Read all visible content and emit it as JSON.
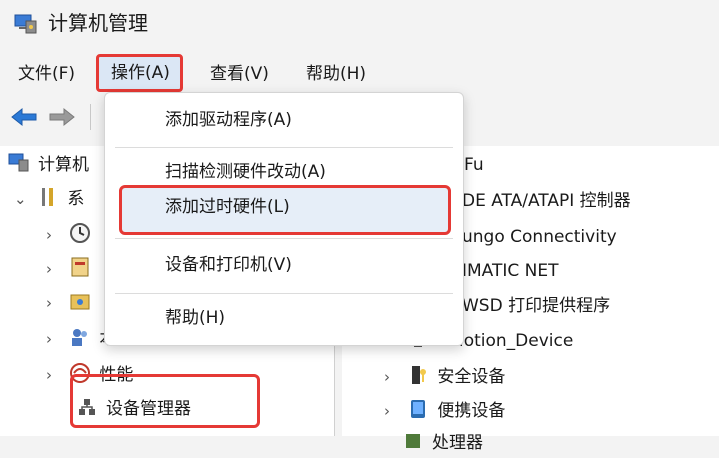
{
  "window": {
    "title": "计算机管理"
  },
  "menubar": {
    "items": [
      {
        "label": "文件(F)"
      },
      {
        "label": "操作(A)"
      },
      {
        "label": "查看(V)"
      },
      {
        "label": "帮助(H)"
      }
    ]
  },
  "dropdown": {
    "items": [
      {
        "label": "添加驱动程序(A)"
      },
      {
        "label": "扫描检测硬件改动(A)"
      },
      {
        "label": "添加过时硬件(L)"
      },
      {
        "label": "设备和打印机(V)"
      },
      {
        "label": "帮助(H)"
      }
    ]
  },
  "left_tree": {
    "root_label": "计算机",
    "system_tools_label": "系",
    "local_users_label": "本地用户和组",
    "performance_label": "性能",
    "device_manager_label": "设备管理器"
  },
  "right_list": {
    "items": [
      {
        "label": "Fu"
      },
      {
        "label": "DE ATA/ATAPI 控制器"
      },
      {
        "label": "ungo Connectivity"
      },
      {
        "label": "IMATIC NET"
      },
      {
        "label": "WSD 打印提供程序"
      },
      {
        "label": "ZMotion_Device"
      },
      {
        "label": "安全设备"
      },
      {
        "label": "便携设备"
      },
      {
        "label": "处理器"
      }
    ]
  },
  "colors": {
    "highlight_border": "#e53935",
    "accent_blue": "#2b6cb0"
  }
}
